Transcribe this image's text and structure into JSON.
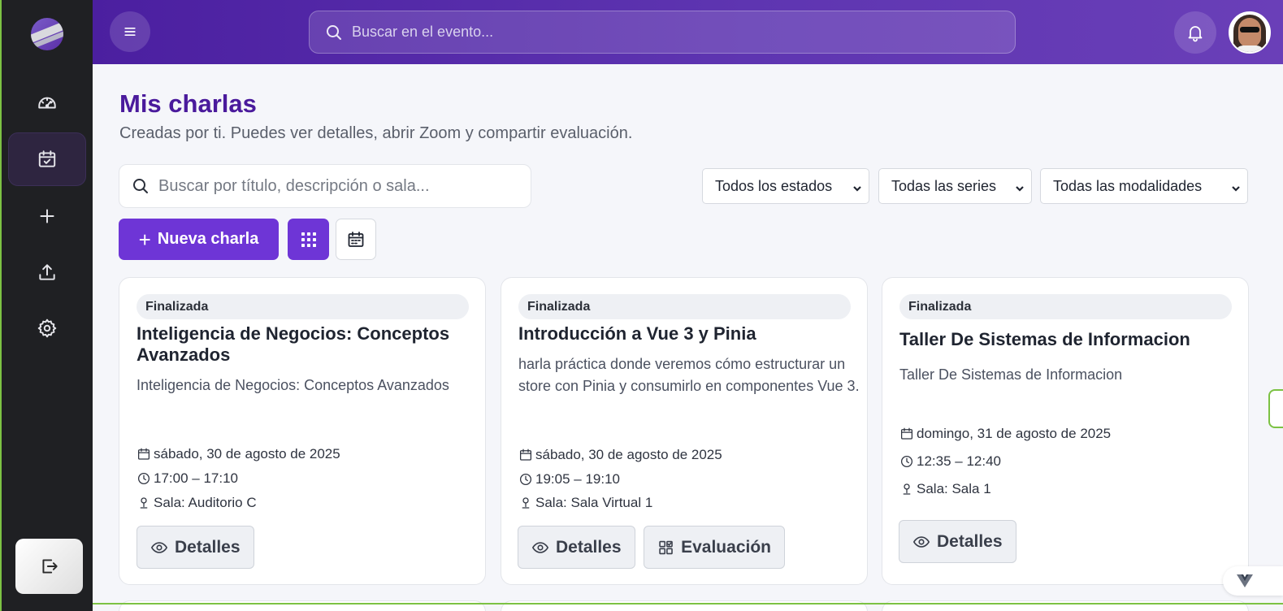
{
  "header": {
    "search_placeholder": "Buscar en el evento..."
  },
  "sidebar": {
    "items": [
      {
        "icon": "dashboard-gauge-icon",
        "active": false
      },
      {
        "icon": "calendar-check-icon",
        "active": true
      },
      {
        "icon": "plus-icon",
        "active": false
      },
      {
        "icon": "upload-icon",
        "active": false
      },
      {
        "icon": "gear-icon",
        "active": false
      }
    ],
    "logout_icon": "logout-icon"
  },
  "page": {
    "title": "Mis charlas",
    "subtitle": "Creadas por ti. Puedes ver detalles, abrir Zoom y compartir evaluación.",
    "search_placeholder": "Buscar por título, descripción o sala...",
    "filters": {
      "estado": "Todos los estados",
      "series": "Todas las series",
      "modalidad": "Todas las modalidades"
    },
    "new_button": "Nueva charla"
  },
  "cards": [
    {
      "status": "Finalizada",
      "title": "Inteligencia de Negocios: Conceptos Avanzados",
      "description": "Inteligencia de Negocios: Conceptos Avanzados",
      "date": "sábado, 30 de agosto de 2025",
      "time": "17:00 – 17:10",
      "room": "Sala: Auditorio C",
      "details_label": "Detalles"
    },
    {
      "status": "Finalizada",
      "title": "Introducción a Vue 3 y Pinia",
      "description": "harla práctica donde veremos cómo estructurar un store con Pinia y consumirlo en componentes Vue 3.",
      "date": "sábado, 30 de agosto de 2025",
      "time": "19:05 – 19:10",
      "room": "Sala: Sala Virtual 1",
      "details_label": "Detalles",
      "evaluation_label": "Evaluación"
    },
    {
      "status": "Finalizada",
      "title": "Taller De Sistemas de Informacion",
      "description": "Taller De Sistemas de Informacion",
      "date": "domingo, 31 de agosto de 2025",
      "time": "12:35 – 12:40",
      "room": "Sala: Sala 1",
      "details_label": "Detalles"
    }
  ],
  "colors": {
    "brand": "#5e35b1",
    "accent": "#6e35d6",
    "title": "#4a1a9c",
    "sidebar": "#1f2023"
  }
}
